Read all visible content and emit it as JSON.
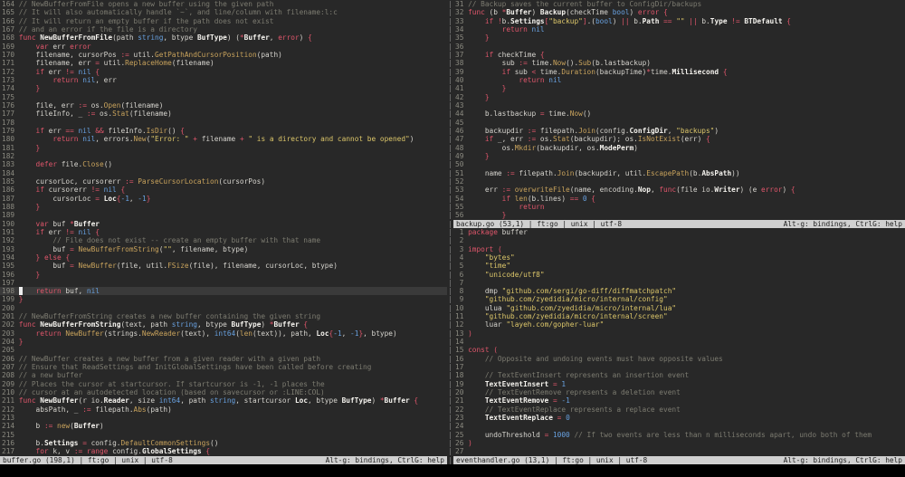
{
  "help_text": "Alt-g: bindings, CtrlG: help",
  "colors": {
    "background": "#282828",
    "cursor_line": "#3a3a3a",
    "text": "#d6d4ce",
    "bright": "#f5f3ee",
    "keyword": "#e0566b",
    "type_number": "#68a1e0",
    "string": "#ddc76a",
    "call": "#c9a35c",
    "comment": "#7d7c71",
    "line_number": "#8b8a80",
    "statusbar_bg": "#d0d0d0",
    "statusbar_text": "#1e1e1e",
    "divider": "#808080",
    "cursor": "#eeeeee",
    "cmdline_bg": "#000000"
  },
  "panes": [
    {
      "file": "buffer.go",
      "status": "buffer.go (198,1) | ft:go | unix | utf-8",
      "first_line": 164,
      "gutter_chars": 3,
      "active": true,
      "cursor": {
        "line": 198,
        "col": 1
      },
      "lines": [
        "// NewBufferFromFile opens a new buffer using the given path",
        "// It will also automatically handle `~`, and line/column with filename:l:c",
        "// It will return an empty buffer if the path does not exist",
        "// and an error if the file is a directory",
        "func NewBufferFromFile(path string, btype BufType) (*Buffer, error) {",
        "\tvar err error",
        "\tfilename, cursorPos := util.GetPathAndCursorPosition(path)",
        "\tfilename, err = util.ReplaceHome(filename)",
        "\tif err != nil {",
        "\t\treturn nil, err",
        "\t}",
        "",
        "\tfile, err := os.Open(filename)",
        "\tfileInfo, _ := os.Stat(filename)",
        "",
        "\tif err == nil && fileInfo.IsDir() {",
        "\t\treturn nil, errors.New(\"Error: \" + filename + \" is a directory and cannot be opened\")",
        "\t}",
        "",
        "\tdefer file.Close()",
        "",
        "\tcursorLoc, cursorerr := ParseCursorLocation(cursorPos)",
        "\tif cursorerr != nil {",
        "\t\tcursorLoc = Loc{-1, -1}",
        "\t}",
        "",
        "\tvar buf *Buffer",
        "\tif err != nil {",
        "\t\t// File does not exist -- create an empty buffer with that name",
        "\t\tbuf = NewBufferFromString(\"\", filename, btype)",
        "\t} else {",
        "\t\tbuf = NewBuffer(file, util.FSize(file), filename, cursorLoc, btype)",
        "\t}",
        "",
        "\treturn buf, nil",
        "}",
        "",
        "// NewBufferFromString creates a new buffer containing the given string",
        "func NewBufferFromString(text, path string, btype BufType) *Buffer {",
        "\treturn NewBuffer(strings.NewReader(text), int64(len(text)), path, Loc{-1, -1}, btype)",
        "}",
        "",
        "// NewBuffer creates a new buffer from a given reader with a given path",
        "// Ensure that ReadSettings and InitGlobalSettings have been called before creating",
        "// a new buffer",
        "// Places the cursor at startcursor. If startcursor is -1, -1 places the",
        "// cursor at an autodetected location (based on savecursor or :LINE:COL)",
        "func NewBuffer(r io.Reader, size int64, path string, startcursor Loc, btype BufType) *Buffer {",
        "\tabsPath, _ := filepath.Abs(path)",
        "",
        "\tb := new(Buffer)",
        "",
        "\tb.Settings = config.DefaultCommonSettings()",
        "\tfor k, v := range config.GlobalSettings {"
      ]
    },
    {
      "file": "backup.go",
      "status": "backup.go (53,1) | ft:go | unix | utf-8",
      "first_line": 31,
      "gutter_chars": 2,
      "active": false,
      "cursor": {
        "line": 53,
        "col": 1
      },
      "lines": [
        "// Backup saves the current buffer to ConfigDir/backups",
        "func (b *Buffer) Backup(checkTime bool) error {",
        "\tif !b.Settings[\"backup\"].(bool) || b.Path == \"\" || b.Type != BTDefault {",
        "\t\treturn nil",
        "\t}",
        "",
        "\tif checkTime {",
        "\t\tsub := time.Now().Sub(b.lastbackup)",
        "\t\tif sub < time.Duration(backupTime)*time.Millisecond {",
        "\t\t\treturn nil",
        "\t\t}",
        "\t}",
        "",
        "\tb.lastbackup = time.Now()",
        "",
        "\tbackupdir := filepath.Join(config.ConfigDir, \"backups\")",
        "\tif _, err := os.Stat(backupdir); os.IsNotExist(err) {",
        "\t\tos.Mkdir(backupdir, os.ModePerm)",
        "\t}",
        "",
        "\tname := filepath.Join(backupdir, util.EscapePath(b.AbsPath))",
        "",
        "\terr := overwriteFile(name, encoding.Nop, func(file io.Writer) (e error) {",
        "\t\tif len(b.lines) == 0 {",
        "\t\t\treturn",
        "\t\t}"
      ]
    },
    {
      "file": "eventhandler.go",
      "status": "eventhandler.go (13,1) | ft:go | unix | utf-8",
      "first_line": 1,
      "gutter_chars": 2,
      "active": false,
      "cursor": {
        "line": 13,
        "col": 1
      },
      "lines": [
        "package buffer",
        "",
        "import (",
        "\t\"bytes\"",
        "\t\"time\"",
        "\t\"unicode/utf8\"",
        "",
        "\tdmp \"github.com/sergi/go-diff/diffmatchpatch\"",
        "\t\"github.com/zyedidia/micro/internal/config\"",
        "\tulua \"github.com/zyedidia/micro/internal/lua\"",
        "\t\"github.com/zyedidia/micro/internal/screen\"",
        "\tluar \"layeh.com/gopher-luar\"",
        ")",
        "",
        "const (",
        "\t// Opposite and undoing events must have opposite values",
        "",
        "\t// TextEventInsert represents an insertion event",
        "\tTextEventInsert = 1",
        "\t// TextEventRemove represents a deletion event",
        "\tTextEventRemove = -1",
        "\t// TextEventReplace represents a replace event",
        "\tTextEventReplace = 0",
        "",
        "\tundoThreshold = 1000 // If two events are less than n milliseconds apart, undo both of them",
        ")",
        ""
      ]
    }
  ]
}
